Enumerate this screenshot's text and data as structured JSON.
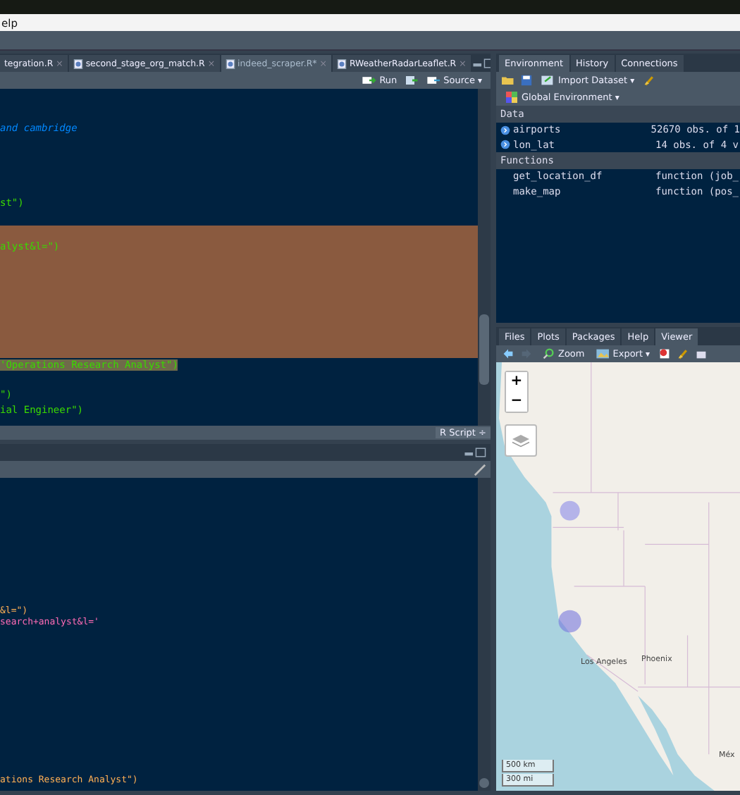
{
  "menu_bar": {
    "items": [
      "elp"
    ]
  },
  "editor": {
    "tabs": [
      {
        "label": "tegration.R",
        "selected": false,
        "icon": false,
        "close": "×"
      },
      {
        "label": "second_stage_org_match.R",
        "selected": false,
        "icon": true,
        "close": "×"
      },
      {
        "label": "indeed_scraper.R*",
        "selected": true,
        "icon": true,
        "close": "×"
      },
      {
        "label": "RWeatherRadarLeaflet.R",
        "selected": false,
        "icon": true,
        "close": "×"
      }
    ],
    "toolbar": {
      "run": "Run",
      "source": "Source",
      "caret": "▾"
    },
    "lines": [
      {
        "text": " and cambridge",
        "kind": "comment",
        "selected": false
      },
      {
        "text": "st\")",
        "kind": "string",
        "selected": false
      },
      {
        "text": "alyst&l=\")",
        "kind": "string",
        "selected": true
      },
      {
        "text": "'Operations Research Analyst\")",
        "kind": "string",
        "selected": true
      },
      {
        "text": "\")",
        "kind": "string",
        "selected": false
      },
      {
        "text": "ial Engineer\")",
        "kind": "string",
        "selected": false
      }
    ],
    "status": {
      "file_type": "R Script",
      "caret": "÷"
    }
  },
  "console": {
    "lines": [
      {
        "text": "&l=\")",
        "kind": "output"
      },
      {
        "text": "search+analyst&l='",
        "kind": "url"
      },
      {
        "text": "ations Research Analyst\")",
        "kind": "output"
      }
    ]
  },
  "environment": {
    "tabs": [
      {
        "label": "Environment",
        "selected": true
      },
      {
        "label": "History",
        "selected": false
      },
      {
        "label": "Connections",
        "selected": false
      }
    ],
    "import": "Import Dataset",
    "caret": "▾",
    "scope": "Global Environment",
    "sections": [
      {
        "title": "Data",
        "rows": [
          {
            "name": "airports",
            "value": "52670 obs. of 1",
            "kind": "data"
          },
          {
            "name": "lon_lat",
            "value": "14 obs. of 4 v",
            "kind": "data"
          }
        ]
      },
      {
        "title": "Functions",
        "rows": [
          {
            "name": "get_location_df",
            "value": "function (job_",
            "kind": "function"
          },
          {
            "name": "make_map",
            "value": "function (pos_",
            "kind": "function"
          }
        ]
      }
    ]
  },
  "viewer": {
    "tabs": [
      {
        "label": "Files",
        "selected": false
      },
      {
        "label": "Plots",
        "selected": false
      },
      {
        "label": "Packages",
        "selected": false
      },
      {
        "label": "Help",
        "selected": false
      },
      {
        "label": "Viewer",
        "selected": true
      }
    ],
    "zoom": "Zoom",
    "export": "Export",
    "caret": "▾",
    "map": {
      "zoom_in": "+",
      "zoom_out": "−",
      "cities": [
        "Los Angeles",
        "Phoenix",
        "Méx"
      ],
      "scale": [
        "500 km",
        "300 mi"
      ]
    }
  }
}
